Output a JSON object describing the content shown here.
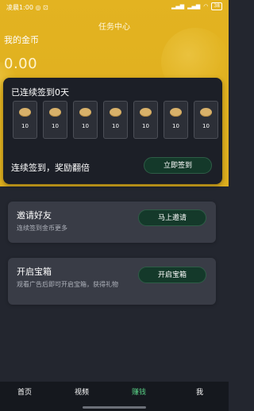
{
  "status_bar": {
    "time": "凌晨1:00",
    "extra": "◎ ⊡",
    "battery": "38"
  },
  "page": {
    "title": "任务中心",
    "gold_label": "我的金币",
    "gold_value": "0.00"
  },
  "checkin": {
    "streak_text": "已连续签到0天",
    "days": [
      {
        "value": "10"
      },
      {
        "value": "10"
      },
      {
        "value": "10"
      },
      {
        "value": "10"
      },
      {
        "value": "10"
      },
      {
        "value": "10"
      },
      {
        "value": "10"
      }
    ],
    "bonus_text": "连续签到，奖励翻倍",
    "button_label": "立即签到"
  },
  "tasks": [
    {
      "title": "邀请好友",
      "description": "连续签到金币更多",
      "button_label": "马上邀请"
    },
    {
      "title": "开启宝箱",
      "description": "观看广告后即可开启宝箱，获得礼物",
      "button_label": "开启宝箱"
    }
  ],
  "bottom_nav": {
    "items": [
      "首页",
      "视频",
      "赚钱",
      "我"
    ],
    "active_index": 2
  },
  "colors": {
    "header_gold": "#e3b321",
    "card_dark": "#1c1f27",
    "task_card": "#393c46",
    "button_green": "#14392a",
    "active_nav": "#59d186"
  },
  "icons": {
    "signal": "signal-icon",
    "wifi": "wifi-icon",
    "battery": "battery-icon",
    "coin": "coin-icon"
  }
}
